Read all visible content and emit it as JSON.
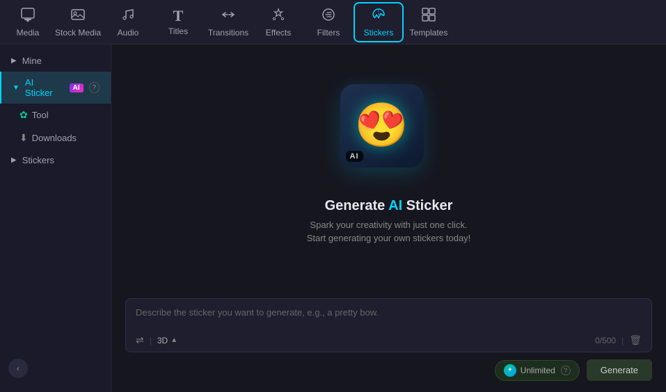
{
  "nav": {
    "items": [
      {
        "id": "media",
        "label": "Media",
        "icon": "🖼",
        "active": false
      },
      {
        "id": "stock-media",
        "label": "Stock Media",
        "icon": "📷",
        "active": false
      },
      {
        "id": "audio",
        "label": "Audio",
        "icon": "🎵",
        "active": false
      },
      {
        "id": "titles",
        "label": "Titles",
        "icon": "T",
        "active": false
      },
      {
        "id": "transitions",
        "label": "Transitions",
        "icon": "▶",
        "active": false
      },
      {
        "id": "effects",
        "label": "Effects",
        "icon": "✦",
        "active": false
      },
      {
        "id": "filters",
        "label": "Filters",
        "icon": "◈",
        "active": false
      },
      {
        "id": "stickers",
        "label": "Stickers",
        "icon": "✦",
        "active": true
      },
      {
        "id": "templates",
        "label": "Templates",
        "icon": "⊞",
        "active": false
      }
    ]
  },
  "sidebar": {
    "items": [
      {
        "id": "mine",
        "label": "Mine",
        "arrow": "▶",
        "active": false
      },
      {
        "id": "ai-sticker",
        "label": "AI Sticker",
        "ai_badge": "AI",
        "active": true
      },
      {
        "id": "tool",
        "label": "Tool",
        "active": false
      },
      {
        "id": "downloads",
        "label": "Downloads",
        "active": false
      },
      {
        "id": "stickers",
        "label": "Stickers",
        "arrow": "▶",
        "active": false
      }
    ],
    "collapse_arrow": "‹"
  },
  "content": {
    "title": "Generate AI Sticker",
    "ai_word": "AI",
    "subtitle_line1": "Spark your creativity with just one click.",
    "subtitle_line2": "Start generating your own stickers today!",
    "emoji": "😍"
  },
  "input": {
    "placeholder": "Describe the sticker you want to generate, e.g., a pretty bow.",
    "style_label": "3D",
    "char_count": "0/500",
    "unlimited_label": "Unlimited",
    "generate_label": "Generate"
  }
}
